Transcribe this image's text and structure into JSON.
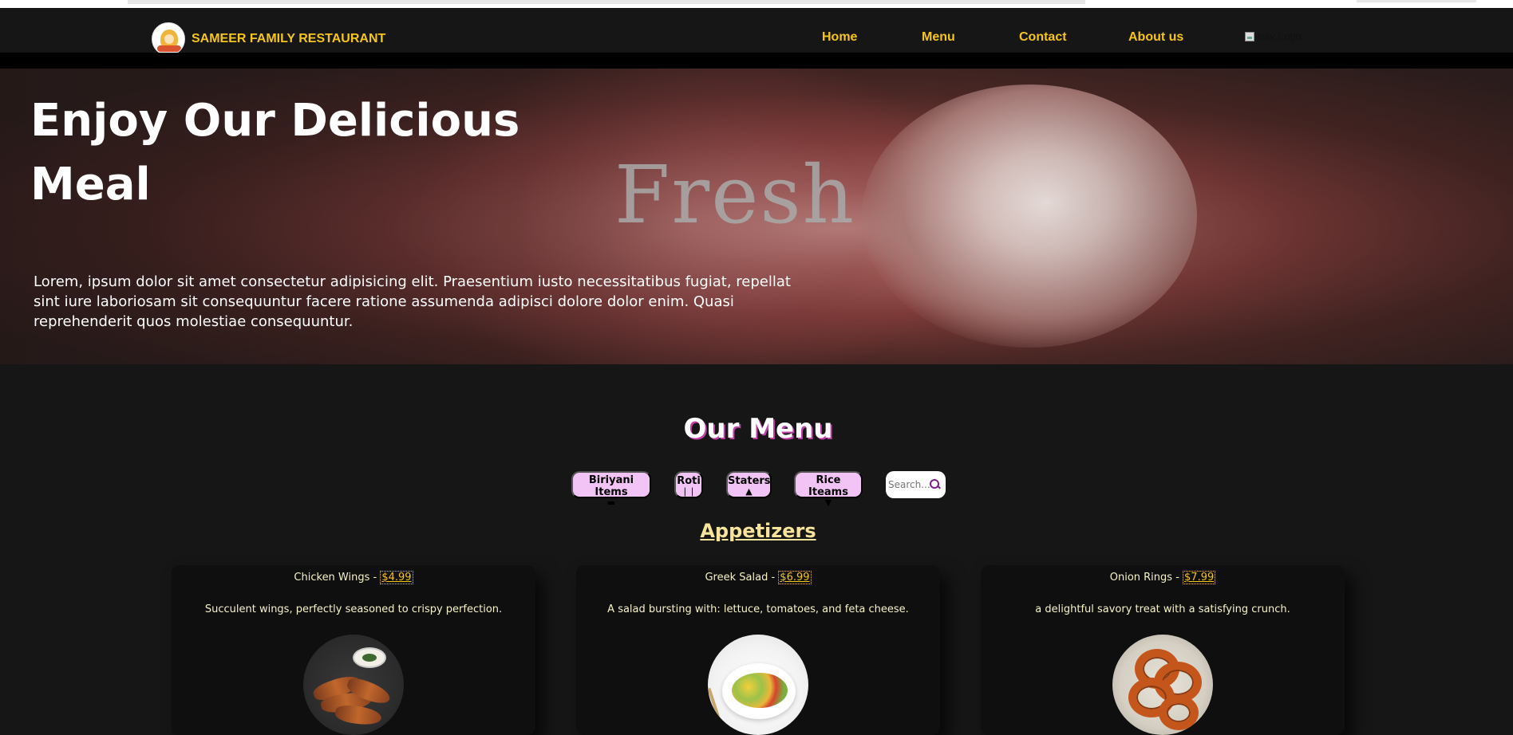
{
  "nav": {
    "brand": "SAMEER FAMILY RESTAURANT",
    "links": [
      "Home",
      "Menu",
      "Contact",
      "About us"
    ],
    "logo_alt": "Nav Logo",
    "link_color": "#f5c518"
  },
  "hero": {
    "title": "Enjoy Our Delicious Meal",
    "text": "Lorem, ipsum dolor sit amet consectetur adipisicing elit. Praesentium iusto necessitatibus fugiat, repellat sint iure laboriosam sit consequuntur facere ratione assumenda adipisci dolore dolor enim. Quasi reprehenderit quos molestiae consequuntur.",
    "background_word": "Fresh"
  },
  "menu": {
    "title": "Our Menu",
    "categories": [
      {
        "label": "Biriyani Items",
        "icon": "burger-icon"
      },
      {
        "label": "Roti",
        "icon": "utensils-icon"
      },
      {
        "label": "Staters",
        "icon": "cloche-icon"
      },
      {
        "label": "Rice Iteams",
        "icon": "cocktail-icon"
      }
    ],
    "search_placeholder": "Search...",
    "section": "Appetizers",
    "items": [
      {
        "name": "Chicken Wings",
        "price": "$4.99",
        "description": "Succulent wings, perfectly seasoned to crispy perfection.",
        "image": "chicken-wings-image"
      },
      {
        "name": "Greek Salad",
        "price": "$6.99",
        "description": "A salad bursting with: lettuce, tomatoes, and feta cheese.",
        "image": "greek-salad-image"
      },
      {
        "name": "Onion Rings",
        "price": "$7.99",
        "description": "a delightful savory treat with a satisfying crunch.",
        "image": "onion-rings-image"
      }
    ]
  },
  "colors": {
    "background": "#161616",
    "accent": "#f5c518",
    "pill": "#f2c4f5",
    "title_shadow": "#c03fa8"
  }
}
